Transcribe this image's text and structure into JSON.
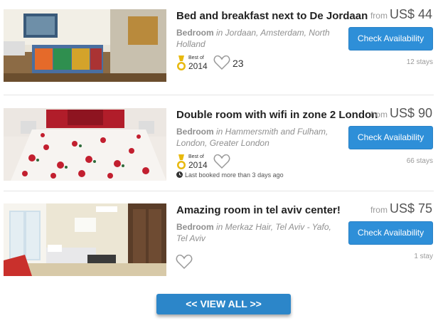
{
  "listings": [
    {
      "title": "Bed and breakfast next to De Jordaan",
      "room_type": "Bedroom",
      "location": " in Jordaan, Amsterdam, North Holland",
      "price_from": "from",
      "price": "US$ 44",
      "button": "Check Availability",
      "stays": "12 stays",
      "badge_label": "Best of",
      "badge_year": "2014",
      "likes": "23"
    },
    {
      "title": "Double room with wifi in zone 2 London",
      "room_type": "Bedroom",
      "location": " in Hammersmith and Fulham, London, Greater London",
      "price_from": "from",
      "price": "US$ 90",
      "button": "Check Availability",
      "stays": "66 stays",
      "badge_label": "Best of",
      "badge_year": "2014",
      "last_booked": "Last booked more than 3 days ago"
    },
    {
      "title": "Amazing room in tel aviv center!",
      "room_type": "Bedroom",
      "location": " in Merkaz Hair, Tel Aviv - Yafo, Tel Aviv",
      "price_from": "from",
      "price": "US$ 75",
      "button": "Check Availability",
      "stays": "1 stay"
    }
  ],
  "view_all": "<< VIEW ALL >>",
  "colors": {
    "button": "#2e8fd8",
    "view_all": "#2c86c9",
    "medal": "#e8b90e"
  },
  "icons": [
    "medal-icon",
    "heart-icon",
    "clock-icon"
  ]
}
